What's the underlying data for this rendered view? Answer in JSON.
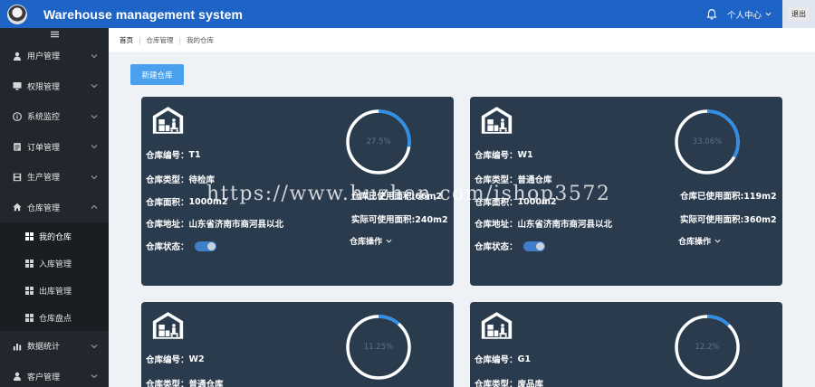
{
  "header": {
    "title": "Warehouse management system",
    "user_center": "个人中心",
    "logout": "退出"
  },
  "sidebar": {
    "items": [
      {
        "label": "用户管理",
        "icon": "user-icon"
      },
      {
        "label": "权限管理",
        "icon": "monitor-icon"
      },
      {
        "label": "系统监控",
        "icon": "info-icon"
      },
      {
        "label": "订单管理",
        "icon": "clipboard-icon"
      },
      {
        "label": "生产管理",
        "icon": "save-icon"
      },
      {
        "label": "仓库管理",
        "icon": "home-icon"
      },
      {
        "label": "数据统计",
        "icon": "bar-chart-icon"
      },
      {
        "label": "客户管理",
        "icon": "user-icon"
      }
    ],
    "sub_items": [
      {
        "label": "我的仓库",
        "active": true
      },
      {
        "label": "入库管理"
      },
      {
        "label": "出库管理"
      },
      {
        "label": "仓库盘点"
      }
    ]
  },
  "breadcrumb": [
    "首页",
    "仓库管理",
    "我的仓库"
  ],
  "main": {
    "new_button": "新建仓库",
    "cards": [
      {
        "code_label": "仓库编号：",
        "code": "T1",
        "type_label": "仓库类型：",
        "type": "待检库",
        "area_label": "仓库面积：",
        "area": "1000m2",
        "addr_label": "仓库地址：",
        "addr": "山东省济南市商河县以北",
        "status_label": "仓库状态：",
        "percent": "27.5%",
        "percent_value": 27.5,
        "used_area": "仓库已使用面积:66m2",
        "avail_area": "实际可使用面积:240m2",
        "ops": "仓库操作"
      },
      {
        "code_label": "仓库编号：",
        "code": "W1",
        "type_label": "仓库类型：",
        "type": "普通仓库",
        "area_label": "仓库面积：",
        "area": "1000m2",
        "addr_label": "仓库地址：",
        "addr": "山东省济南市商河县以北",
        "status_label": "仓库状态：",
        "percent": "33.06%",
        "percent_value": 33.06,
        "used_area": "仓库已使用面积:119m2",
        "avail_area": "实际可使用面积:360m2",
        "ops": "仓库操作"
      },
      {
        "code_label": "仓库编号：",
        "code": "W2",
        "type_label": "仓库类型：",
        "type": "普通仓库",
        "percent": "11.25%",
        "percent_value": 11.25
      },
      {
        "code_label": "仓库编号：",
        "code": "G1",
        "type_label": "仓库类型：",
        "type": "废品库",
        "percent": "12.2%",
        "percent_value": 12.2
      }
    ]
  },
  "watermark": "https://www.huzhan.com/ishop3572",
  "colors": {
    "header": "#1e63c6",
    "sidebar": "#22272d",
    "card": "#2a3b4e",
    "accent": "#2f8fe8",
    "button": "#4aa0ef"
  }
}
